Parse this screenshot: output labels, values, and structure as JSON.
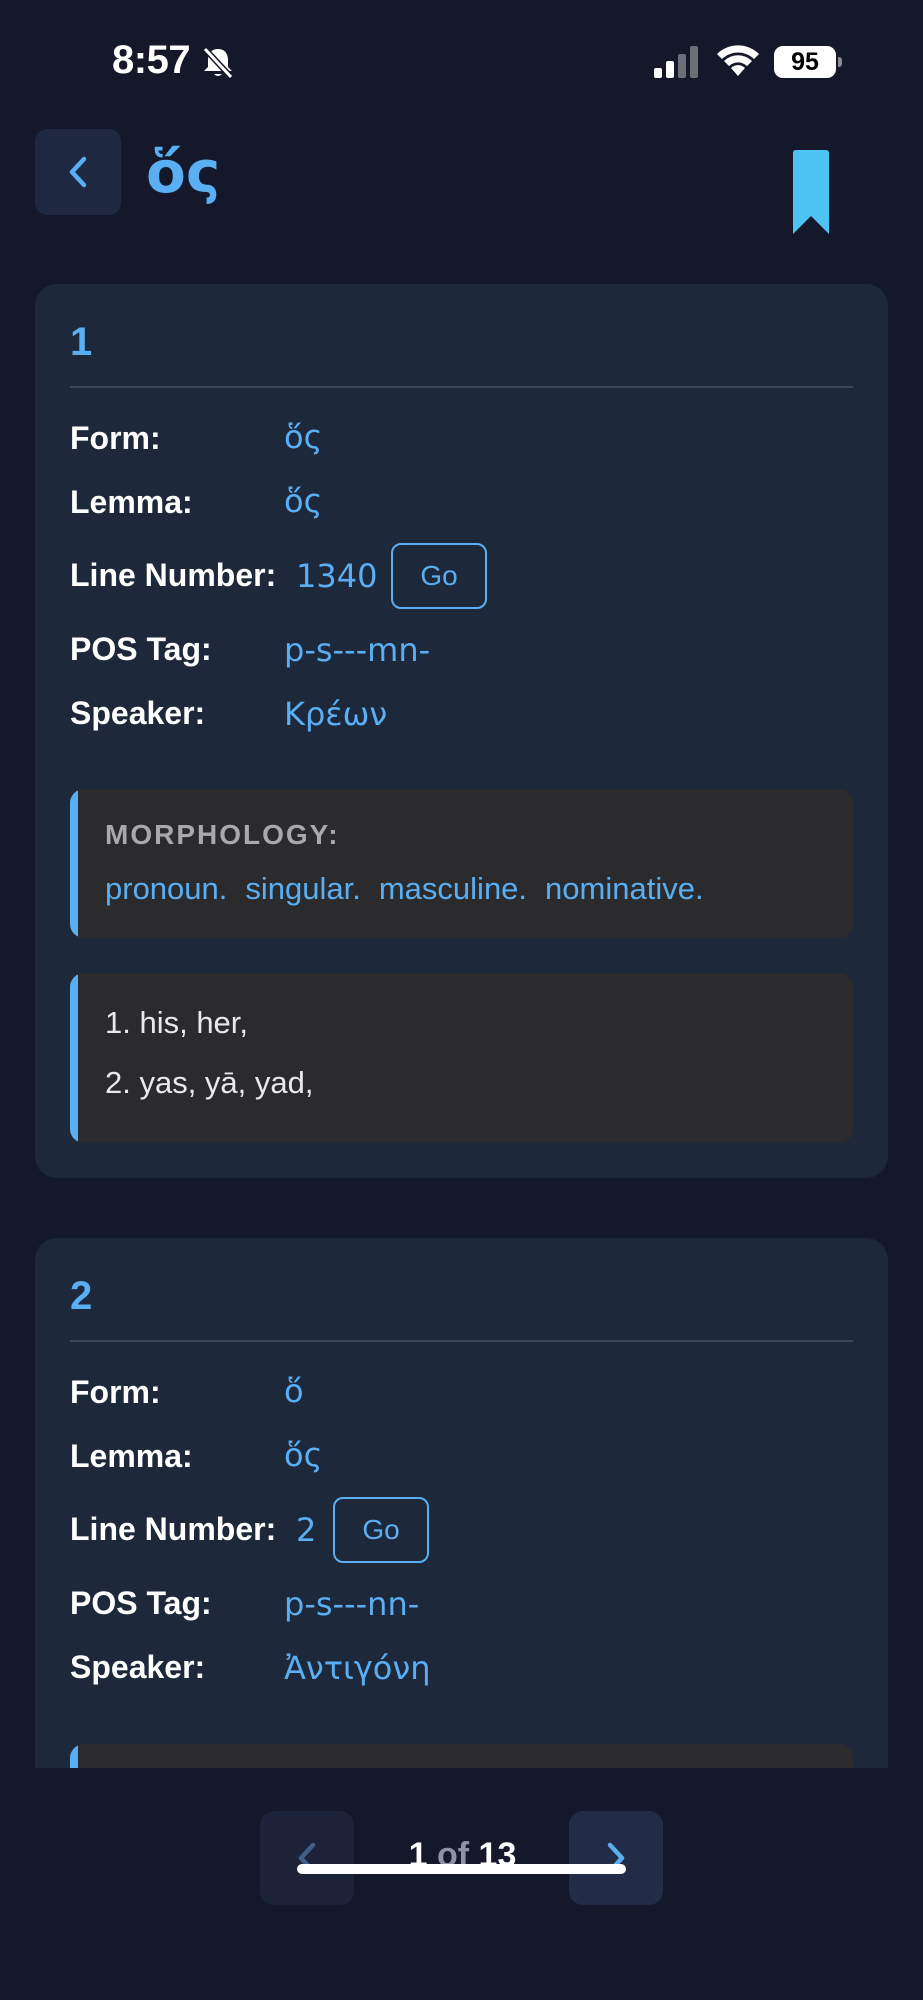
{
  "status_bar": {
    "time": "8:57",
    "battery": "95"
  },
  "header": {
    "title": "ὅς"
  },
  "colors": {
    "accent": "#5aaef2",
    "bookmark": "#4cc3f1",
    "card_bg": "#1e283b",
    "box_bg": "#2b2b2d",
    "page_bg": "#15172a"
  },
  "icons": {
    "back": "chevron-left-icon",
    "bookmark": "bookmark-icon",
    "prev": "chevron-left-icon",
    "next": "chevron-right-icon"
  },
  "entries": [
    {
      "number": "1",
      "labels": {
        "form": "Form:",
        "lemma": "Lemma:",
        "line_number": "Line Number:",
        "pos_tag": "POS Tag:",
        "speaker": "Speaker:"
      },
      "form": "ὅς",
      "lemma": "ὅς",
      "line_number": "1340",
      "go_label": "Go",
      "pos_tag": "p-s---mn-",
      "speaker": "Κρέων",
      "morphology_label": "MORPHOLOGY:",
      "morphology": [
        "pronoun.",
        "singular.",
        "masculine.",
        "nominative."
      ],
      "definitions": [
        "1. his, her,",
        "2. yas, yā, yad,"
      ]
    },
    {
      "number": "2",
      "labels": {
        "form": "Form:",
        "lemma": "Lemma:",
        "line_number": "Line Number:",
        "pos_tag": "POS Tag:",
        "speaker": "Speaker:"
      },
      "form": "ὅ",
      "lemma": "ὅς",
      "line_number": "2",
      "go_label": "Go",
      "pos_tag": "p-s---nn-",
      "speaker": "Ἀντιγόνη"
    }
  ],
  "pagination": {
    "current": "1",
    "of_label": "of",
    "total": "13"
  }
}
